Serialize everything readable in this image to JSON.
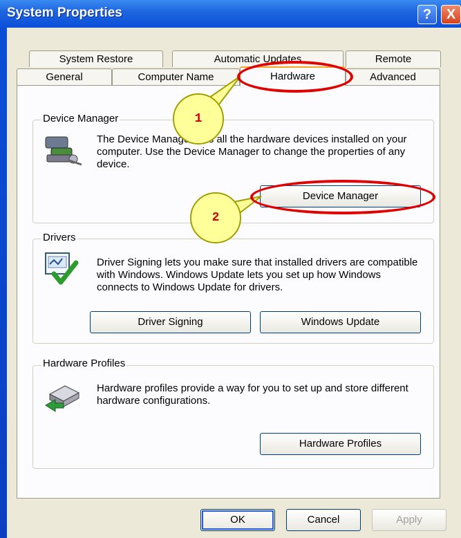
{
  "window": {
    "title": "System Properties",
    "help_glyph": "?",
    "close_glyph": "X"
  },
  "tabs": {
    "row_back": [
      "System Restore",
      "Automatic Updates",
      "Remote"
    ],
    "row_front": [
      "General",
      "Computer Name",
      "Hardware",
      "Advanced"
    ],
    "active": "Hardware"
  },
  "device_manager": {
    "group_label": "Device Manager",
    "description": "The Device Manager lists all the hardware devices installed on your computer. Use the Device Manager to change the properties of any device.",
    "button_label": "Device Manager",
    "icon": "device-manager-icon"
  },
  "drivers": {
    "group_label": "Drivers",
    "description": "Driver Signing lets you make sure that installed drivers are compatible with Windows. Windows Update lets you set up how Windows connects to Windows Update for drivers.",
    "driver_signing_label": "Driver Signing",
    "windows_update_label": "Windows Update",
    "icon": "driver-certificate-icon"
  },
  "hardware_profiles": {
    "group_label": "Hardware Profiles",
    "description": "Hardware profiles provide a way for you to set up and store different hardware configurations.",
    "button_label": "Hardware Profiles",
    "icon": "hardware-profile-icon"
  },
  "footer": {
    "ok_label": "OK",
    "cancel_label": "Cancel",
    "apply_label": "Apply"
  },
  "annotations": {
    "step1": "1",
    "step2": "2",
    "highlight_color": "#e00000",
    "callout_color": "#ffff99"
  },
  "colors": {
    "titlebar": "#0a4fd8",
    "dialog_bg": "#ece9d8",
    "active_tab_accent": "#f5a623"
  }
}
